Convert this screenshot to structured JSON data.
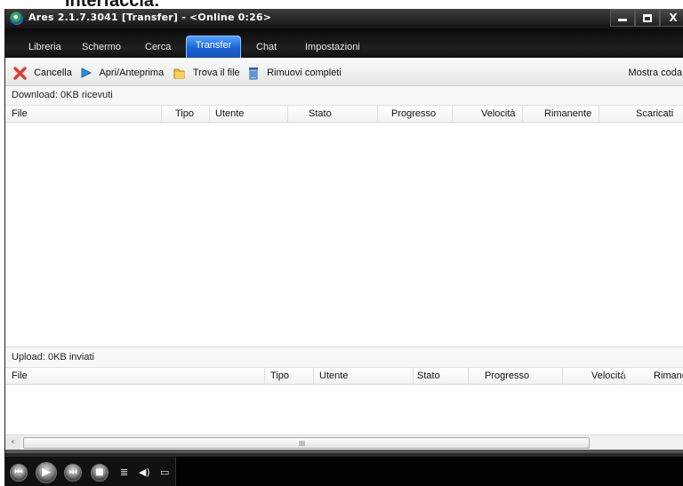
{
  "caption": "Interfaccia:",
  "window": {
    "title": "Ares 2.1.7.3041  [Transfer]  - <Online 0:26>",
    "controls": {
      "minimize": "",
      "maximize": "",
      "close": "X"
    }
  },
  "tabs": [
    {
      "label": "Libreria"
    },
    {
      "label": "Schermo"
    },
    {
      "label": "Cerca"
    },
    {
      "label": "Transfer",
      "active": true
    },
    {
      "label": "Chat"
    },
    {
      "label": "Impostazioni"
    }
  ],
  "toolbar": {
    "items": [
      {
        "label": "Cancella",
        "icon": "red-x-icon"
      },
      {
        "label": "Apri/Anteprima",
        "icon": "play-arrow-icon"
      },
      {
        "label": "Trova il file",
        "icon": "folder-icon"
      },
      {
        "label": "Rimuovi completi",
        "icon": "trash-bin-icon"
      }
    ],
    "show_queue": "Mostra coda"
  },
  "download": {
    "title": "Download: 0KB ricevuti",
    "columns": [
      "File",
      "Tipo",
      "Utente",
      "Stato",
      "Progresso",
      "Velocità",
      "Rimanente",
      "Scaricati"
    ]
  },
  "upload": {
    "title": "Upload: 0KB inviati",
    "columns": [
      "File",
      "Tipo",
      "Utente",
      "Stato",
      "Progresso",
      "Velocità",
      "Rimane"
    ]
  },
  "scrollbar": {
    "left_arrow": "‹",
    "grip": "III"
  },
  "colors": {
    "active_tab": "#1c63d8",
    "titlebar": "#1a1a1a",
    "cancel_icon": "#e23a2b",
    "open_icon": "#2e8ae6",
    "folder_icon": "#e5b933"
  },
  "player": {
    "buttons": [
      "previous",
      "play",
      "next",
      "stop"
    ],
    "icons": [
      "playlist-icon",
      "volume-icon",
      "video-window-icon"
    ]
  }
}
